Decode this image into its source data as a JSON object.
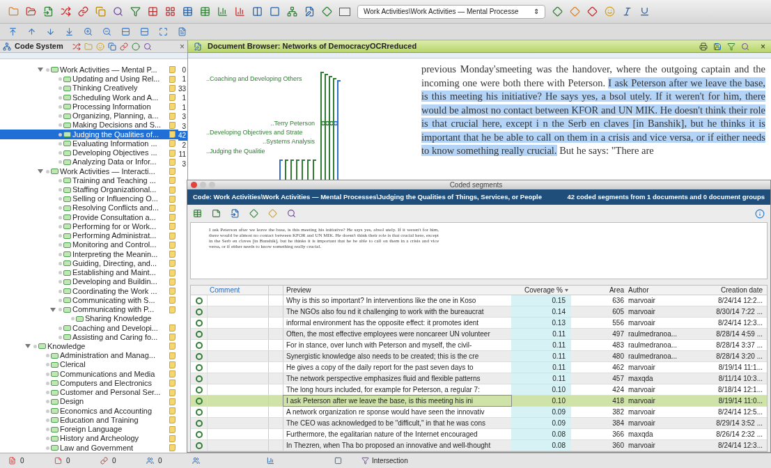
{
  "toolbar": {
    "code_selector": {
      "value": "Work Activities\\Work Activities — Mental Processe",
      "spinner": "⇕"
    }
  },
  "code_system": {
    "title": "Code System",
    "close": "×",
    "tree": [
      {
        "children": [
          {
            "label": "Work Activities — Mental P...",
            "count": "0",
            "memo": true,
            "expanded": true,
            "selected": false,
            "children": [
              {
                "label": "Updating and Using Rel...",
                "count": "1",
                "memo": true,
                "selected": false
              },
              {
                "label": "Thinking Creatively",
                "count": "33",
                "memo": true,
                "selected": false
              },
              {
                "label": "Scheduling Work and A...",
                "count": "1",
                "memo": true,
                "selected": false
              },
              {
                "label": "Processing Information",
                "count": "1",
                "memo": true,
                "selected": false
              },
              {
                "label": "Organizing, Planning, a...",
                "count": "3",
                "memo": true,
                "selected": false
              },
              {
                "label": "Making Decisions and S...",
                "count": "3",
                "memo": true,
                "selected": false
              },
              {
                "label": "Judging the Qualities of...",
                "count": "42",
                "memo": true,
                "selected": true
              },
              {
                "label": "Evaluating Information ...",
                "count": "2",
                "memo": true,
                "selected": false
              },
              {
                "label": "Developing Objectives ...",
                "count": "11",
                "memo": true,
                "selected": false
              },
              {
                "label": "Analyzing Data or Infor...",
                "count": "3",
                "memo": true,
                "selected": false
              }
            ]
          },
          {
            "label": "Work Activities — Interacti...",
            "memo": true,
            "expanded": true,
            "selected": false,
            "children": [
              {
                "label": "Training and Teaching ...",
                "memo": true,
                "selected": false
              },
              {
                "label": "Staffing Organizational...",
                "memo": true,
                "selected": false
              },
              {
                "label": "Selling or Influencing O...",
                "memo": true,
                "selected": false
              },
              {
                "label": "Resolving Conflicts and...",
                "memo": true,
                "selected": false
              },
              {
                "label": "Provide Consultation a...",
                "memo": true,
                "selected": false
              },
              {
                "label": "Performing for or Work...",
                "memo": true,
                "selected": false
              },
              {
                "label": "Performing Administrat...",
                "memo": true,
                "selected": false
              },
              {
                "label": "Monitoring and Control...",
                "memo": true,
                "selected": false
              },
              {
                "label": "Interpreting the Meanin...",
                "memo": true,
                "selected": false
              },
              {
                "label": "Guiding, Directing, and...",
                "memo": true,
                "selected": false
              },
              {
                "label": "Establishing and Maint...",
                "memo": true,
                "selected": false
              },
              {
                "label": "Developing and Buildin...",
                "memo": true,
                "selected": false
              },
              {
                "label": "Coordinating the Work ...",
                "memo": true,
                "selected": false
              },
              {
                "label": "Communicating with S...",
                "memo": true,
                "selected": false
              },
              {
                "label": "Communicating with P...",
                "memo": true,
                "expanded": true,
                "selected": false,
                "children": [
                  {
                    "label": "Sharing Knowledge",
                    "selected": false
                  }
                ]
              },
              {
                "label": "Coaching and Developi...",
                "memo": true,
                "selected": false
              },
              {
                "label": "Assisting and Caring fo...",
                "memo": true,
                "selected": false
              }
            ]
          }
        ]
      },
      {
        "label": "Knowledge",
        "memo": true,
        "expanded": true,
        "selected": false,
        "children": [
          {
            "label": "Administration and Manag...",
            "memo": true,
            "selected": false
          },
          {
            "label": "Clerical",
            "memo": true,
            "selected": false
          },
          {
            "label": "Communications and Media",
            "memo": true,
            "selected": false
          },
          {
            "label": "Computers and Electronics",
            "memo": true,
            "selected": false
          },
          {
            "label": "Customer and Personal Ser...",
            "memo": true,
            "selected": false
          },
          {
            "label": "Design",
            "memo": true,
            "selected": false
          },
          {
            "label": "Economics and Accounting",
            "memo": true,
            "selected": false
          },
          {
            "label": "Education and Training",
            "memo": true,
            "selected": false
          },
          {
            "label": "Foreign Language",
            "memo": true,
            "selected": false
          },
          {
            "label": "History and Archeology",
            "memo": true,
            "selected": false
          },
          {
            "label": "Law and Government",
            "memo": true,
            "selected": false
          }
        ]
      }
    ]
  },
  "document_browser": {
    "title": "Document Browser: Networks of DemocracyOCRreduced",
    "close": "×",
    "stripe_labels": [
      {
        "text": "..Coaching and Developing Others"
      },
      {
        "text": "..Terry Peterson"
      },
      {
        "text": "..Developing Objectives and Strate"
      },
      {
        "text": "..Systems Analysis"
      },
      {
        "text": "..Judging the Qualitie"
      }
    ],
    "text": [
      {
        "text": "previous Monday'smeeting was the handover, where the outgoing captain and the incoming one were both there with Peterson. ",
        "highlighted": false
      },
      {
        "text": "I ask Peterson after we leave the base, is this meeting his initiative? He says yes, a bsol utely. If it weren't for him, there would be almost no contact between KFOR and UN MIK. He doesn't think their role is that crucial here, except i n the Serb en claves [in Banshik], but he thinks it is important that he be able to call on them in a crisis and vice versa, or if either needs to know something really crucial.",
        "highlighted": true
      },
      {
        "text": " But he says: \"There are",
        "highlighted": false
      }
    ]
  },
  "coded_segments": {
    "title": "Coded segments",
    "code_path": "Code: Work Activities\\Work Activities — Mental Processes\\Judging the Qualities of Things, Services, or People",
    "summary": "42 coded segments from 1 documents and 0 document groups",
    "preview": "I ask Peterson after we leave the base, is this meeting his initiative? He says yes, absol utely. If it weren't for him, there would be almost no contact between KFOR and UN MIK. He doesn't think their role is that crucial here, except in the Serb en claves [in Banshik], but he thinks it is important that he be able to call on them in a crisis and vice versa, or if either needs to know something really crucial.",
    "columns": [
      "Comment",
      "Preview",
      "Coverage %",
      "Area",
      "Author",
      "Creation date"
    ],
    "rows": [
      {
        "preview": "Why is this so important? In interventions like the one in Koso",
        "coverage": "0.15",
        "area": "636",
        "author": "marvoair",
        "date": "8/24/14 12:2...",
        "selected": false
      },
      {
        "preview": "The NGOs also fou nd it challenging to work with the bureaucrat",
        "coverage": "0.14",
        "area": "605",
        "author": "marvoair",
        "date": "8/30/14 7:22 ...",
        "selected": false
      },
      {
        "preview": "informal environment has the opposite effect: it promotes ident",
        "coverage": "0.13",
        "area": "556",
        "author": "marvoair",
        "date": "8/24/14 12:3...",
        "selected": false
      },
      {
        "preview": "Often, the most effective employees were noncareer UN volunteer",
        "coverage": "0.11",
        "area": "497",
        "author": "raulmedranoa...",
        "date": "8/28/14 4:59 ...",
        "selected": false
      },
      {
        "preview": "For in stance, over lunch with Peterson and myself, the civil-",
        "coverage": "0.11",
        "area": "483",
        "author": "raulmedranoa...",
        "date": "8/28/14 3:37 ...",
        "selected": false
      },
      {
        "preview": "Synergistic knowledge also needs to be created; this is the cre",
        "coverage": "0.11",
        "area": "480",
        "author": "raulmedranoa...",
        "date": "8/28/14 3:20 ...",
        "selected": false
      },
      {
        "preview": "He gives a copy of the daily report for the past seven days to",
        "coverage": "0.11",
        "area": "462",
        "author": "marvoair",
        "date": "8/19/14 11:1...",
        "selected": false
      },
      {
        "preview": "The network perspective emphasizes fluid and flexible patterns",
        "coverage": "0.11",
        "area": "457",
        "author": "maxqda",
        "date": "8/11/14 10:3...",
        "selected": false
      },
      {
        "preview": "The long hours included, for example for Peterson, a regular 7:",
        "coverage": "0.10",
        "area": "424",
        "author": "marvoair",
        "date": "8/18/14 12:1...",
        "selected": false
      },
      {
        "preview": "I ask Peterson after we leave the base, is this meeting his ini",
        "coverage": "0.10",
        "area": "418",
        "author": "marvoair",
        "date": "8/19/14 11:0...",
        "selected": true
      },
      {
        "preview": "A network organization re sponse would have seen the innovativ",
        "coverage": "0.09",
        "area": "382",
        "author": "marvoair",
        "date": "8/24/14 12:5...",
        "selected": false
      },
      {
        "preview": "The CEO was acknowledged to be \"difficult,\" in that he was cons",
        "coverage": "0.09",
        "area": "384",
        "author": "marvoair",
        "date": "8/29/14 3:52 ...",
        "selected": false
      },
      {
        "preview": "Furthermore, the egalitarian nature of the Internet encouraged",
        "coverage": "0.08",
        "area": "366",
        "author": "maxqda",
        "date": "8/26/14 2:32 ...",
        "selected": false
      },
      {
        "preview": "In Thezren, when Tha bo proposed an innovative and well-thought",
        "coverage": "0.08",
        "area": "360",
        "author": "marvoair",
        "date": "8/24/14 12:3...",
        "selected": false
      }
    ]
  },
  "status_bar": {
    "counts": [
      "0",
      "0",
      "0",
      "0"
    ],
    "intersection": "Intersection"
  }
}
